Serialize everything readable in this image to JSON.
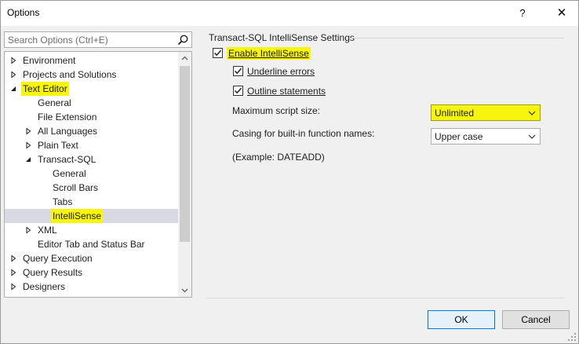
{
  "window": {
    "title": "Options",
    "help_label": "?",
    "close_label": "✕"
  },
  "search": {
    "placeholder": "Search Options (Ctrl+E)"
  },
  "tree": {
    "items": [
      {
        "label": "Environment",
        "arrow": "collapsed",
        "level": 0
      },
      {
        "label": "Projects and Solutions",
        "arrow": "collapsed",
        "level": 0
      },
      {
        "label": "Text Editor",
        "arrow": "expanded",
        "level": 0,
        "highlighted": true
      },
      {
        "label": "General",
        "arrow": "none",
        "level": 1
      },
      {
        "label": "File Extension",
        "arrow": "none",
        "level": 1
      },
      {
        "label": "All Languages",
        "arrow": "collapsed",
        "level": 1
      },
      {
        "label": "Plain Text",
        "arrow": "collapsed",
        "level": 1
      },
      {
        "label": "Transact-SQL",
        "arrow": "expanded",
        "level": 1
      },
      {
        "label": "General",
        "arrow": "none",
        "level": 2
      },
      {
        "label": "Scroll Bars",
        "arrow": "none",
        "level": 2
      },
      {
        "label": "Tabs",
        "arrow": "none",
        "level": 2
      },
      {
        "label": "IntelliSense",
        "arrow": "none",
        "level": 2,
        "selected": true,
        "highlighted": true
      },
      {
        "label": "XML",
        "arrow": "collapsed",
        "level": 1
      },
      {
        "label": "Editor Tab and Status Bar",
        "arrow": "none",
        "level": 1
      },
      {
        "label": "Query Execution",
        "arrow": "collapsed",
        "level": 0
      },
      {
        "label": "Query Results",
        "arrow": "collapsed",
        "level": 0
      },
      {
        "label": "Designers",
        "arrow": "collapsed",
        "level": 0
      }
    ]
  },
  "settings": {
    "group_title": "Transact-SQL IntelliSense Settings",
    "enable_intellisense": {
      "label": "Enable IntelliSense",
      "checked": true
    },
    "underline_errors": {
      "label": "Underline errors",
      "checked": true
    },
    "outline_statements": {
      "label": "Outline statements",
      "checked": true
    },
    "max_script_size": {
      "label": "Maximum script size:",
      "value": "Unlimited"
    },
    "casing": {
      "label": "Casing for built-in function names:",
      "value": "Upper case"
    },
    "example": "(Example: DATEADD)"
  },
  "buttons": {
    "ok": "OK",
    "cancel": "Cancel"
  },
  "colors": {
    "highlight": "#f7f50e",
    "selected_row": "#d9d9e3",
    "default_button_border": "#0078d7"
  }
}
